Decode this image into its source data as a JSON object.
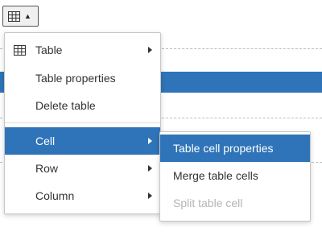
{
  "toolbar": {
    "table_button": {
      "icon": "table-grid-icon",
      "dropdown_icon": "caret-up-icon",
      "arrow": "▲"
    }
  },
  "main_menu": {
    "items": [
      {
        "label": "Table",
        "icon": "table-grid-icon",
        "has_submenu": true
      },
      {
        "label": "Table properties"
      },
      {
        "label": "Delete table"
      },
      {
        "label": "Cell",
        "has_submenu": true,
        "active": true
      },
      {
        "label": "Row",
        "has_submenu": true
      },
      {
        "label": "Column",
        "has_submenu": true
      }
    ]
  },
  "cell_submenu": {
    "items": [
      {
        "label": "Table cell properties",
        "active": true
      },
      {
        "label": "Merge table cells"
      },
      {
        "label": "Split table cell",
        "disabled": true
      }
    ]
  },
  "colors": {
    "accent": "#2f74b8",
    "disabled_text": "#b5b5b5",
    "text": "#333333"
  }
}
